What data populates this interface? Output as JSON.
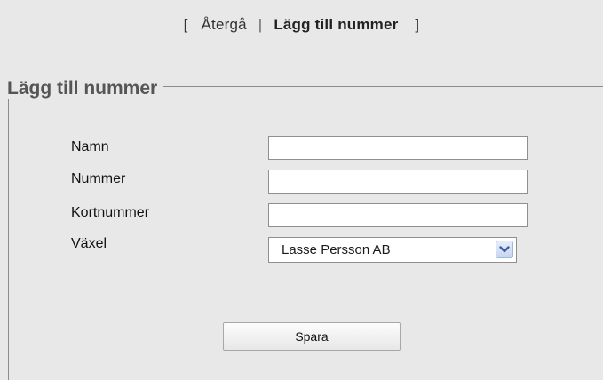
{
  "nav": {
    "open_bracket": "[",
    "back_label": "Återgå",
    "separator": "|",
    "current_label": "Lägg till nummer",
    "close_bracket": "]"
  },
  "form": {
    "legend": "Lägg till nummer",
    "fields": [
      {
        "label": "Namn",
        "value": ""
      },
      {
        "label": "Nummer",
        "value": ""
      },
      {
        "label": "Kortnummer",
        "value": ""
      }
    ],
    "vaxel": {
      "label": "Växel",
      "selected": "Lasse Persson AB"
    },
    "submit_label": "Spara"
  },
  "icons": {
    "select_arrow": "chevron-down-icon"
  },
  "colors": {
    "background": "#e8e8e8",
    "legend_text": "#555555",
    "select_arrow_bg": "#c6d6f0",
    "select_arrow_glyph": "#3a5fa0"
  }
}
